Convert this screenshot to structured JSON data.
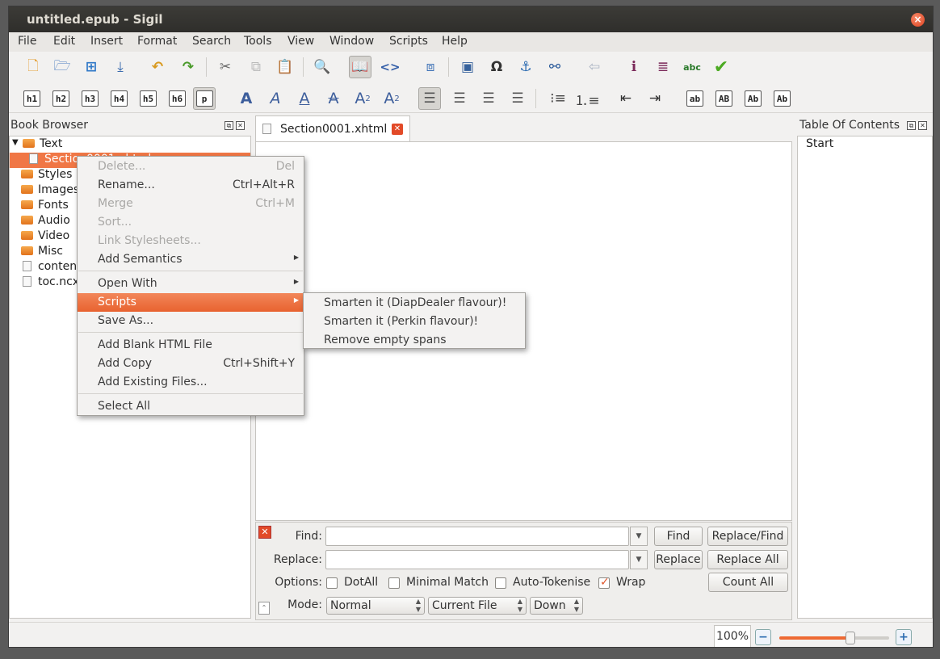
{
  "window": {
    "title": "untitled.epub - Sigil"
  },
  "menubar": [
    "File",
    "Edit",
    "Insert",
    "Format",
    "Search",
    "Tools",
    "View",
    "Window",
    "Scripts",
    "Help"
  ],
  "toolbar2": {
    "headings": [
      "h1",
      "h2",
      "h3",
      "h4",
      "h5",
      "h6",
      "p"
    ],
    "case_buttons": [
      "ab",
      "AB",
      "Ab",
      "Ab"
    ]
  },
  "book_browser": {
    "title": "Book Browser",
    "items": [
      "Text",
      "Section0001.xhtml",
      "Styles",
      "Images",
      "Fonts",
      "Audio",
      "Video",
      "Misc",
      "content.opf",
      "toc.ncx"
    ]
  },
  "editor": {
    "tab_label": "Section0001.xhtml"
  },
  "toc": {
    "title": "Table Of Contents",
    "items": [
      "Start"
    ]
  },
  "find": {
    "find_label": "Find:",
    "replace_label": "Replace:",
    "options_label": "Options:",
    "mode_label": "Mode:",
    "find_btn": "Find",
    "replace_find_btn": "Replace/Find",
    "replace_btn": "Replace",
    "replace_all_btn": "Replace All",
    "count_all_btn": "Count All",
    "opt_dotall": "DotAll",
    "opt_minimal": "Minimal Match",
    "opt_autotok": "Auto-Tokenise",
    "opt_wrap": "Wrap",
    "mode_value": "Normal",
    "scope_value": "Current File",
    "direction_value": "Down"
  },
  "context_menu": {
    "delete": "Delete...",
    "delete_sc": "Del",
    "rename": "Rename...",
    "rename_sc": "Ctrl+Alt+R",
    "merge": "Merge",
    "merge_sc": "Ctrl+M",
    "sort": "Sort...",
    "link": "Link Stylesheets...",
    "semantics": "Add Semantics",
    "open_with": "Open With",
    "scripts": "Scripts",
    "save_as": "Save As...",
    "add_blank": "Add Blank HTML File",
    "add_copy": "Add Copy",
    "add_copy_sc": "Ctrl+Shift+Y",
    "add_existing": "Add Existing Files...",
    "select_all": "Select All"
  },
  "scripts_submenu": [
    "Smarten it (DiapDealer flavour)!",
    "Smarten it (Perkin flavour)!",
    "Remove empty spans"
  ],
  "status": {
    "zoom": "100%",
    "zoom_fraction": 0.65
  },
  "colors": {
    "accent": "#f07746",
    "titlebar": "#3c3b37"
  }
}
